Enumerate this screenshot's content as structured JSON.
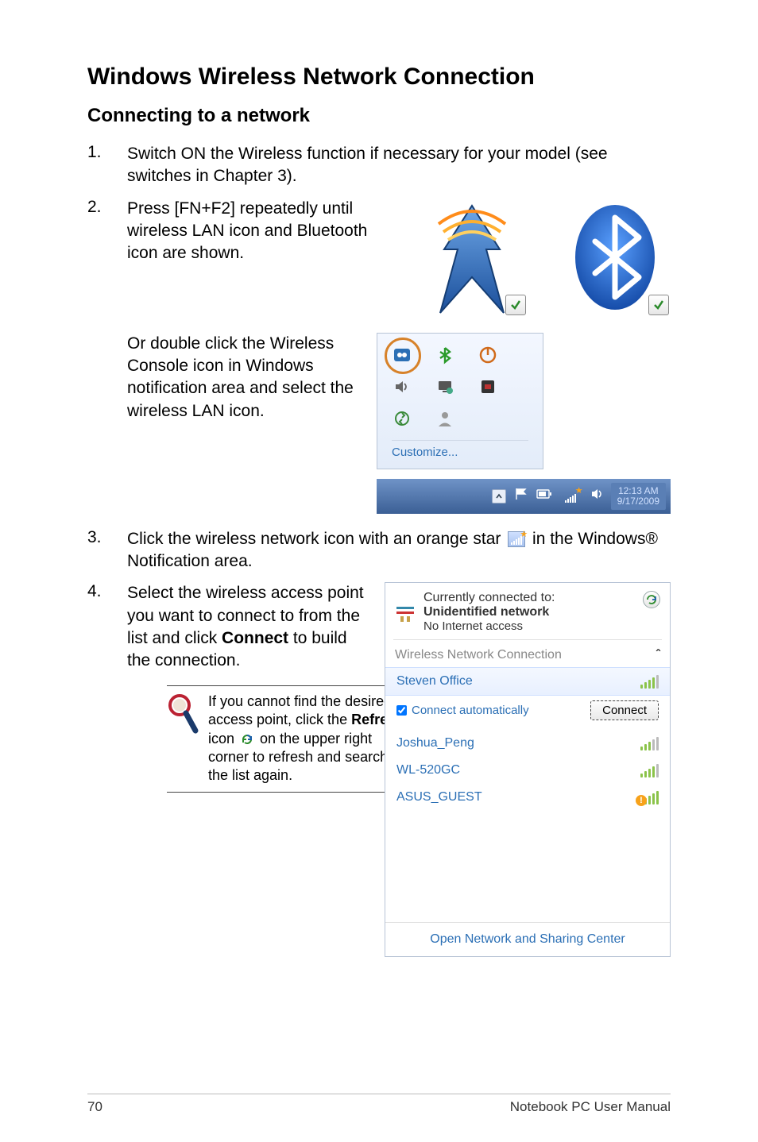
{
  "section_title": "Windows Wireless Network Connection",
  "sub_title": "Connecting to a network",
  "steps": {
    "s1_num": "1.",
    "s1_text": "Switch ON the Wireless function if necessary for your model (see switches in Chapter 3).",
    "s2_num": "2.",
    "s2_text": "Press [FN+F2] repeatedly until wireless LAN icon and Bluetooth icon are shown.",
    "s2b_text": "Or double click the Wireless Console icon in Windows notification area and select the wireless LAN icon.",
    "s3_num": "3.",
    "s3_text_a": "Click the wireless network icon with an orange star ",
    "s3_text_b": " in the Windows® Notification area.",
    "s4_num": "4.",
    "s4_text_a": "Select the wireless access point you want to connect to from the list and click ",
    "s4_text_bold": "Connect",
    "s4_text_b": " to build the connection."
  },
  "tip": {
    "a": "If you cannot find the desired access point, click the ",
    "bold": "Refresh",
    "b": " icon ",
    "c": " on the upper right corner to refresh and search in the list again."
  },
  "systray": {
    "customize": "Customize...",
    "clock_time": "12:13 AM",
    "clock_date": "9/17/2009"
  },
  "net_flyout": {
    "connected_to": "Currently connected to:",
    "unidentified": "Unidentified network",
    "no_access": "No Internet access",
    "section": "Wireless Network Connection",
    "items": [
      {
        "name": "Steven Office"
      },
      {
        "name": "Joshua_Peng"
      },
      {
        "name": "WL-520GC"
      },
      {
        "name": "ASUS_GUEST"
      }
    ],
    "auto_label": "Connect automatically",
    "connect_btn": "Connect",
    "footer": "Open Network and Sharing Center",
    "caret": "ˆ"
  },
  "icons": {
    "check": "✓"
  },
  "footer": {
    "page": "70",
    "manual": "Notebook PC User Manual"
  }
}
